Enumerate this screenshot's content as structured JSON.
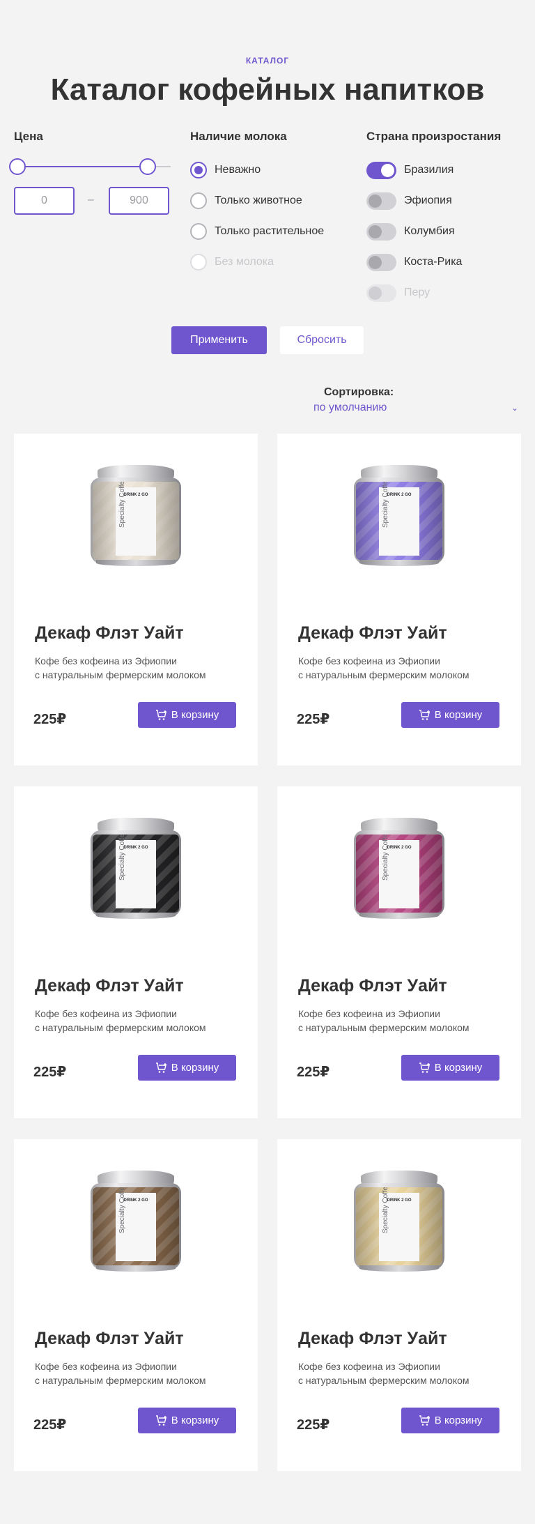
{
  "header": {
    "eyebrow": "КАТАЛОГ",
    "title": "Каталог кофейных напитков"
  },
  "filters": {
    "price": {
      "title": "Цена",
      "min_value": "0",
      "max_value": "900",
      "separator": "–"
    },
    "milk": {
      "title": "Наличие молока",
      "options": [
        {
          "label": "Неважно",
          "checked": true,
          "disabled": false
        },
        {
          "label": "Только животное",
          "checked": false,
          "disabled": false
        },
        {
          "label": "Только растительное",
          "checked": false,
          "disabled": false
        },
        {
          "label": "Без молока",
          "checked": false,
          "disabled": true
        }
      ]
    },
    "country": {
      "title": "Страна произростания",
      "options": [
        {
          "label": "Бразилия",
          "on": true,
          "disabled": false
        },
        {
          "label": "Эфиопия",
          "on": false,
          "disabled": false
        },
        {
          "label": "Колумбия",
          "on": false,
          "disabled": false
        },
        {
          "label": "Коста-Рика",
          "on": false,
          "disabled": false
        },
        {
          "label": "Перу",
          "on": false,
          "disabled": true
        }
      ]
    },
    "apply_label": "Применить",
    "reset_label": "Сбросить"
  },
  "sort": {
    "label": "Сортировка:",
    "value": "по умолчанию"
  },
  "products": [
    {
      "name": "Декаф Флэт Уайт",
      "desc_line1": "Кофе без кофеина из Эфиопии",
      "desc_line2": "с натуральным фермерским молоком",
      "price": "225₽",
      "cart_label": "В корзину",
      "can_color": "#e9e1d2",
      "can_brand": "DRINK 2 GO",
      "can_text": "Specialty Coffee"
    },
    {
      "name": "Декаф Флэт Уайт",
      "desc_line1": "Кофе без кофеина из Эфиопии",
      "desc_line2": "с натуральным фермерским молоком",
      "price": "225₽",
      "cart_label": "В корзину",
      "can_color": "#8e7be4",
      "can_brand": "DRINK 2 GO",
      "can_text": "Specialty Coffee"
    },
    {
      "name": "Декаф Флэт Уайт",
      "desc_line1": "Кофе без кофеина из Эфиопии",
      "desc_line2": "с натуральным фермерским молоком",
      "price": "225₽",
      "cart_label": "В корзину",
      "can_color": "#262628",
      "can_brand": "DRINK 2 GO",
      "can_text": "Specialty Coffee"
    },
    {
      "name": "Декаф Флэт Уайт",
      "desc_line1": "Кофе без кофеина из Эфиопии",
      "desc_line2": "с натуральным фермерским молоком",
      "price": "225₽",
      "cart_label": "В корзину",
      "can_color": "#b3417e",
      "can_brand": "DRINK 2 GO",
      "can_text": "Specialty Coffee"
    },
    {
      "name": "Декаф Флэт Уайт",
      "desc_line1": "Кофе без кофеина из Эфиопии",
      "desc_line2": "с натуральным фермерским молоком",
      "price": "225₽",
      "cart_label": "В корзину",
      "can_color": "#8a6a4c",
      "can_brand": "DRINK 2 GO",
      "can_text": "Specialty Coffee"
    },
    {
      "name": "Декаф Флэт Уайт",
      "desc_line1": "Кофе без кофеина из Эфиопии",
      "desc_line2": "с натуральным фермерским молоком",
      "price": "225₽",
      "cart_label": "В корзину",
      "can_color": "#e7d19a",
      "can_brand": "DRINK 2 GO",
      "can_text": "Specialty Coffee"
    }
  ],
  "colors": {
    "accent": "#6f56cf",
    "background": "#f3f3f4",
    "card": "#ffffff",
    "text": "#333333"
  }
}
